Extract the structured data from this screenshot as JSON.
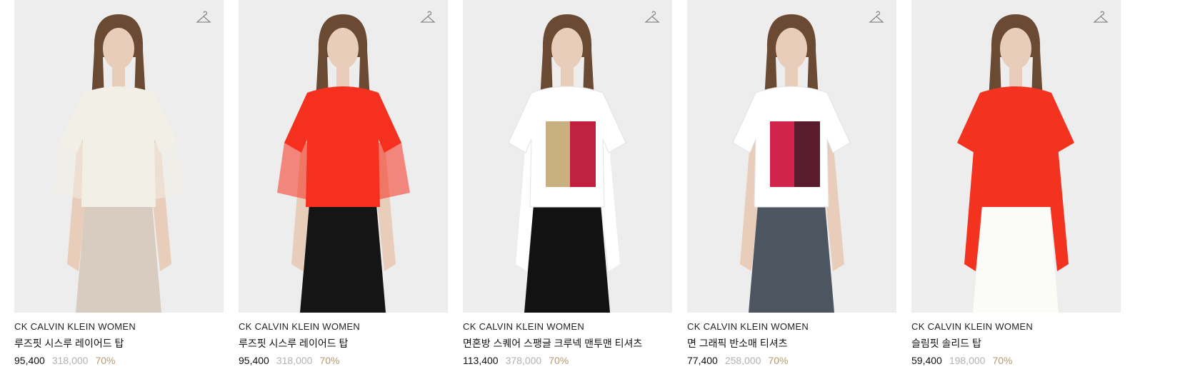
{
  "products": [
    {
      "brand": "CK CALVIN KLEIN WOMEN",
      "name": "루즈핏 시스루 레이어드 탑",
      "price": "95,400",
      "original_price": "318,000",
      "discount": "70%",
      "top_color": "#f1efe6",
      "bottom_color": "#d8ccc0",
      "sleeve": "sheer-short"
    },
    {
      "brand": "CK CALVIN KLEIN WOMEN",
      "name": "루즈핏 시스루 레이어드 탑",
      "price": "95,400",
      "original_price": "318,000",
      "discount": "70%",
      "top_color": "#f5301f",
      "bottom_color": "#151515",
      "sleeve": "sheer-short"
    },
    {
      "brand": "CK CALVIN KLEIN WOMEN",
      "name": "면혼방 스퀘어 스팽글 크루넥 맨투맨 티셔츠",
      "price": "113,400",
      "original_price": "378,000",
      "discount": "70%",
      "top_color": "#ffffff",
      "bottom_color": "#121212",
      "sleeve": "long",
      "graphic": [
        "#c9b07f",
        "#c0213f"
      ]
    },
    {
      "brand": "CK CALVIN KLEIN WOMEN",
      "name": "면 그래픽 반소매 티셔츠",
      "price": "77,400",
      "original_price": "258,000",
      "discount": "70%",
      "top_color": "#ffffff",
      "bottom_color": "#4d5660",
      "sleeve": "short",
      "graphic": [
        "#d0244d",
        "#5a1b2d"
      ]
    },
    {
      "brand": "CK CALVIN KLEIN WOMEN",
      "name": "슬림핏 솔리드 탑",
      "price": "59,400",
      "original_price": "198,000",
      "discount": "70%",
      "top_color": "#f3321f",
      "bottom_color": "#fbfbf8",
      "sleeve": "long"
    }
  ],
  "icons": {
    "wishlist": "hanger-icon"
  },
  "colors": {
    "price": "#111111",
    "original_price": "#b2b2b2",
    "discount": "#b59a6f",
    "photo_bg": "#ededed"
  }
}
